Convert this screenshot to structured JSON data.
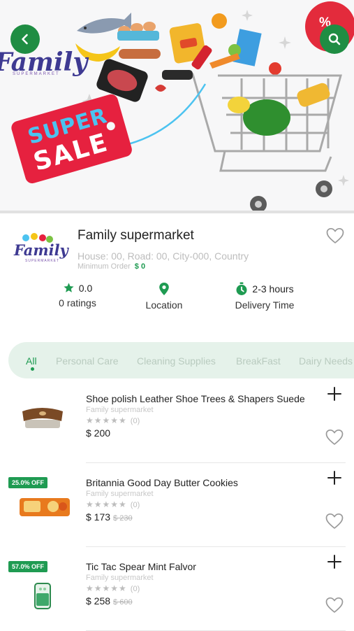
{
  "header": {
    "banner_logo": "Family",
    "banner_logo_sub": "SUPERMARKET",
    "sale_line1": "SUPER",
    "sale_line2": "SALE",
    "sale_badge": "%",
    "back_icon": "chevron-left-icon",
    "search_icon": "search-icon"
  },
  "store": {
    "logo_text": "Family",
    "logo_sub": "SUPERMARKET",
    "name": "Family supermarket",
    "address": "House: 00, Road: 00, City-000, Country",
    "min_order_label": "Minimum Order",
    "min_order_value": "$ 0",
    "ratings_value": "0.0",
    "ratings_label": "0 ratings",
    "location_label": "Location",
    "delivery_value": "2-3 hours",
    "delivery_label": "Delivery Time"
  },
  "tabs": [
    "All",
    "Personal Care",
    "Cleaning Supplies",
    "BreakFast",
    "Dairy Needs"
  ],
  "products": [
    {
      "name": "Shoe polish Leather Shoe Trees & Shapers Suede",
      "seller": "Family supermarket",
      "stars": "★★★★★",
      "rating_count": "(0)",
      "price": "$ 200",
      "old_price": "",
      "discount": ""
    },
    {
      "name": "Britannia Good Day Butter Cookies",
      "seller": "Family supermarket",
      "stars": "★★★★★",
      "rating_count": "(0)",
      "price": "$ 173",
      "old_price": "$ 230",
      "discount": "25.0% OFF"
    },
    {
      "name": "Tic Tac Spear Mint Falvor",
      "seller": "Family supermarket",
      "stars": "★★★★★",
      "rating_count": "(0)",
      "price": "$ 258",
      "old_price": "$ 600",
      "discount": "57.0% OFF"
    }
  ],
  "colors": {
    "primary": "#1f9b52",
    "tab_bg": "#e5f2ea",
    "sale_red": "#e6213f",
    "logo_blue": "#3e3a92"
  }
}
